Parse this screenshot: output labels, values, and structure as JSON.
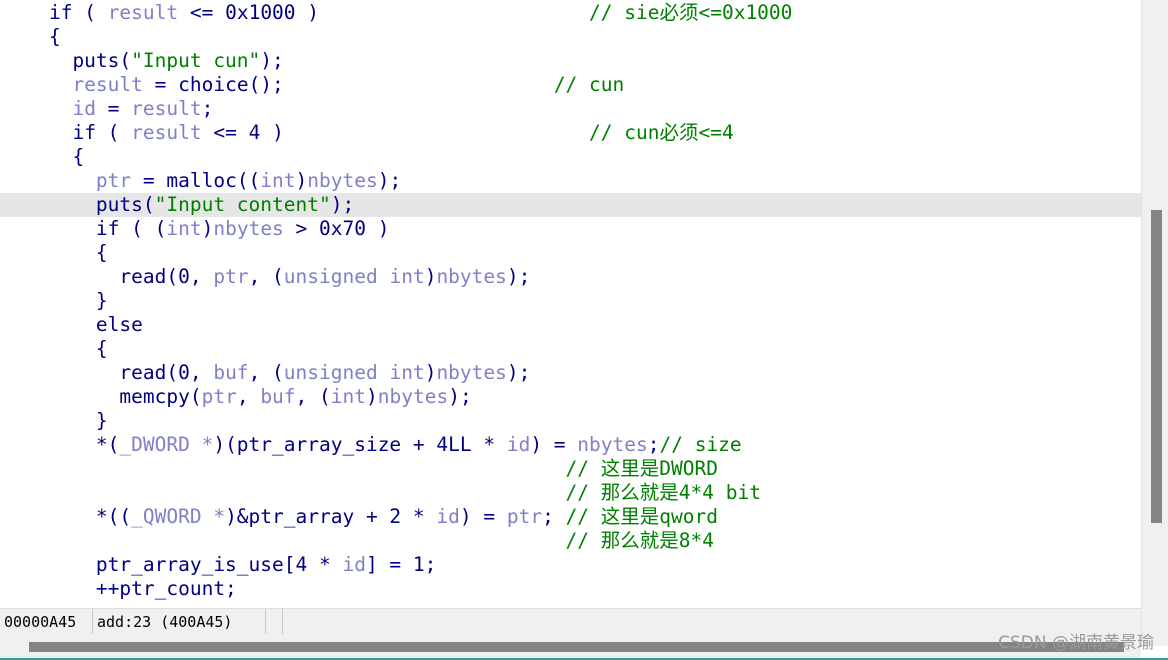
{
  "code_lines": [
    [
      {
        "t": "    "
      },
      {
        "t": "if",
        "c": "kw"
      },
      {
        "t": " ( "
      },
      {
        "t": "result",
        "c": "vr"
      },
      {
        "t": " <= 0x1000 )                       "
      },
      {
        "t": "// sie必须<=0x1000",
        "c": "cm"
      }
    ],
    [
      {
        "t": "    {"
      }
    ],
    [
      {
        "t": "      puts("
      },
      {
        "t": "\"Input cun\"",
        "c": "st"
      },
      {
        "t": ");"
      }
    ],
    [
      {
        "t": "      "
      },
      {
        "t": "result",
        "c": "vr"
      },
      {
        "t": " = choice();                       "
      },
      {
        "t": "// cun",
        "c": "cm"
      }
    ],
    [
      {
        "t": "      "
      },
      {
        "t": "id",
        "c": "vr"
      },
      {
        "t": " = "
      },
      {
        "t": "result",
        "c": "vr"
      },
      {
        "t": ";"
      }
    ],
    [
      {
        "t": "      "
      },
      {
        "t": "if",
        "c": "kw"
      },
      {
        "t": " ( "
      },
      {
        "t": "result",
        "c": "vr"
      },
      {
        "t": " <= 4 )                          "
      },
      {
        "t": "// cun必须<=4",
        "c": "cm"
      }
    ],
    [
      {
        "t": "      {"
      }
    ],
    [
      {
        "t": "        "
      },
      {
        "t": "ptr",
        "c": "vr"
      },
      {
        "t": " = malloc(("
      },
      {
        "t": "int",
        "c": "vr"
      },
      {
        "t": ")"
      },
      {
        "t": "nbytes",
        "c": "vr"
      },
      {
        "t": ");"
      }
    ],
    [
      {
        "t": "        puts("
      },
      {
        "t": "\"Input content\"",
        "c": "st"
      },
      {
        "t": ");"
      }
    ],
    [
      {
        "t": "        "
      },
      {
        "t": "if",
        "c": "kw"
      },
      {
        "t": " ( ("
      },
      {
        "t": "int",
        "c": "vr"
      },
      {
        "t": ")"
      },
      {
        "t": "nbytes",
        "c": "vr"
      },
      {
        "t": " > 0x70 )"
      }
    ],
    [
      {
        "t": "        {"
      }
    ],
    [
      {
        "t": "          read(0, "
      },
      {
        "t": "ptr",
        "c": "vr"
      },
      {
        "t": ", ("
      },
      {
        "t": "unsigned int",
        "c": "vr"
      },
      {
        "t": ")"
      },
      {
        "t": "nbytes",
        "c": "vr"
      },
      {
        "t": ");"
      }
    ],
    [
      {
        "t": "        }"
      }
    ],
    [
      {
        "t": "        else"
      }
    ],
    [
      {
        "t": "        {"
      }
    ],
    [
      {
        "t": "          read(0, "
      },
      {
        "t": "buf",
        "c": "vr"
      },
      {
        "t": ", ("
      },
      {
        "t": "unsigned int",
        "c": "vr"
      },
      {
        "t": ")"
      },
      {
        "t": "nbytes",
        "c": "vr"
      },
      {
        "t": ");"
      }
    ],
    [
      {
        "t": "          memcpy("
      },
      {
        "t": "ptr",
        "c": "vr"
      },
      {
        "t": ", "
      },
      {
        "t": "buf",
        "c": "vr"
      },
      {
        "t": ", ("
      },
      {
        "t": "int",
        "c": "vr"
      },
      {
        "t": ")"
      },
      {
        "t": "nbytes",
        "c": "vr"
      },
      {
        "t": ");"
      }
    ],
    [
      {
        "t": "        }"
      }
    ],
    [
      {
        "t": "        *("
      },
      {
        "t": "_DWORD *",
        "c": "vr"
      },
      {
        "t": ")(ptr_array_size + 4LL * "
      },
      {
        "t": "id",
        "c": "vr"
      },
      {
        "t": ") = "
      },
      {
        "t": "nbytes",
        "c": "vr"
      },
      {
        "t": ";"
      },
      {
        "t": "// size",
        "c": "cm"
      }
    ],
    [
      {
        "t": "                                                "
      },
      {
        "t": "// 这里是DWORD",
        "c": "cm"
      }
    ],
    [
      {
        "t": "                                                "
      },
      {
        "t": "// 那么就是4*4 bit",
        "c": "cm"
      }
    ],
    [
      {
        "t": "        *(("
      },
      {
        "t": "_QWORD *",
        "c": "vr"
      },
      {
        "t": ")&ptr_array + 2 * "
      },
      {
        "t": "id",
        "c": "vr"
      },
      {
        "t": ") = "
      },
      {
        "t": "ptr",
        "c": "vr"
      },
      {
        "t": "; "
      },
      {
        "t": "// 这里是qword",
        "c": "cm"
      }
    ],
    [
      {
        "t": "                                                "
      },
      {
        "t": "// 那么就是8*4",
        "c": "cm"
      }
    ],
    [
      {
        "t": "        ptr_array_is_use[4 * "
      },
      {
        "t": "id",
        "c": "vr"
      },
      {
        "t": "] = 1;"
      }
    ],
    [
      {
        "t": "        ++ptr_count;"
      }
    ]
  ],
  "highlighted_line": 8,
  "status": {
    "address": "00000A45",
    "location": "add:23 (400A45)"
  },
  "scroll": {
    "vertical_fraction_start": 0.32,
    "vertical_fraction_size": 0.5,
    "horizontal_fraction_start": 0.025,
    "horizontal_fraction_size": 0.96
  },
  "watermark": "CSDN @湖南黄景瑜"
}
